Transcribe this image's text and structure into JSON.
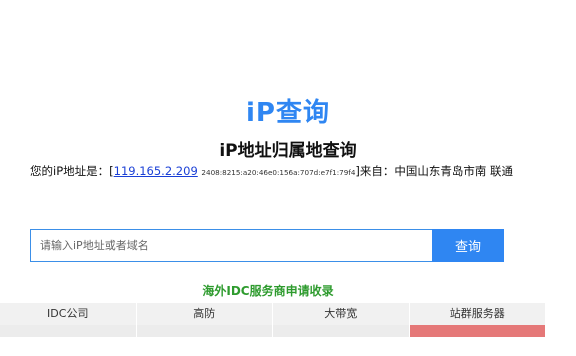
{
  "logo": {
    "text": "iP查询"
  },
  "subtitle": "iP地址归属地查询",
  "ip_info": {
    "prefix": "您的iP地址是：[",
    "ipv4": "119.165.2.209",
    "ipv6": "2408:8215:a20:46e0:156a:707d:e7f1:79f4",
    "suffix": "]来自：中国山东青岛市南 联通"
  },
  "search": {
    "placeholder": "请输入iP地址或者域名",
    "button_label": "查询"
  },
  "apply_link": "海外IDC服务商申请收录",
  "table": {
    "headers": [
      "IDC公司",
      "高防",
      "大带宽",
      "站群服务器"
    ]
  },
  "colors": {
    "accent": "#2f86f2",
    "link_green": "#2e9b2e",
    "highlight_red": "#e57878"
  }
}
